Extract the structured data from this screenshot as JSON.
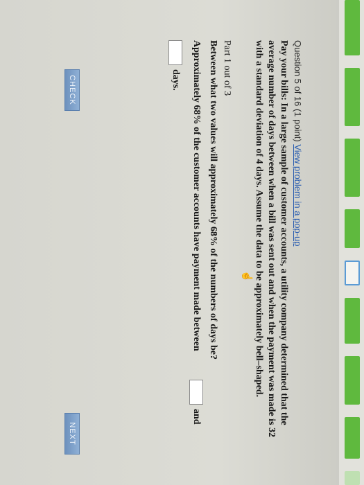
{
  "question": {
    "header_prefix": "Question 5 of 16 (1 point)",
    "popup_link": "View problem in a pop-up",
    "problem_line1": "Pay your bills: In a large sample of customer accounts, a utility company determined that the",
    "problem_line2": "average number of days between when a bill was sent out and when the payment was made is 32",
    "problem_line3": "with a standard deviation of 4 days. Assume the data to be approximately bell–shaped."
  },
  "part": {
    "label": "Part 1 out of 3",
    "question": "Between what two values will approximately 68% of the numbers of days be?",
    "approx_line": "Approximately 68% of the customer accounts have payment made between",
    "and_word": "and",
    "days_word": "days."
  },
  "buttons": {
    "check": "CHECK",
    "next": "NEXT"
  },
  "colors": {
    "progress_done": "#5fb93e",
    "progress_current_border": "#5b9bd5",
    "link": "#2a5db0",
    "button": "#7a9cc6"
  },
  "icons": {
    "cursor": "hand-cursor-icon"
  }
}
